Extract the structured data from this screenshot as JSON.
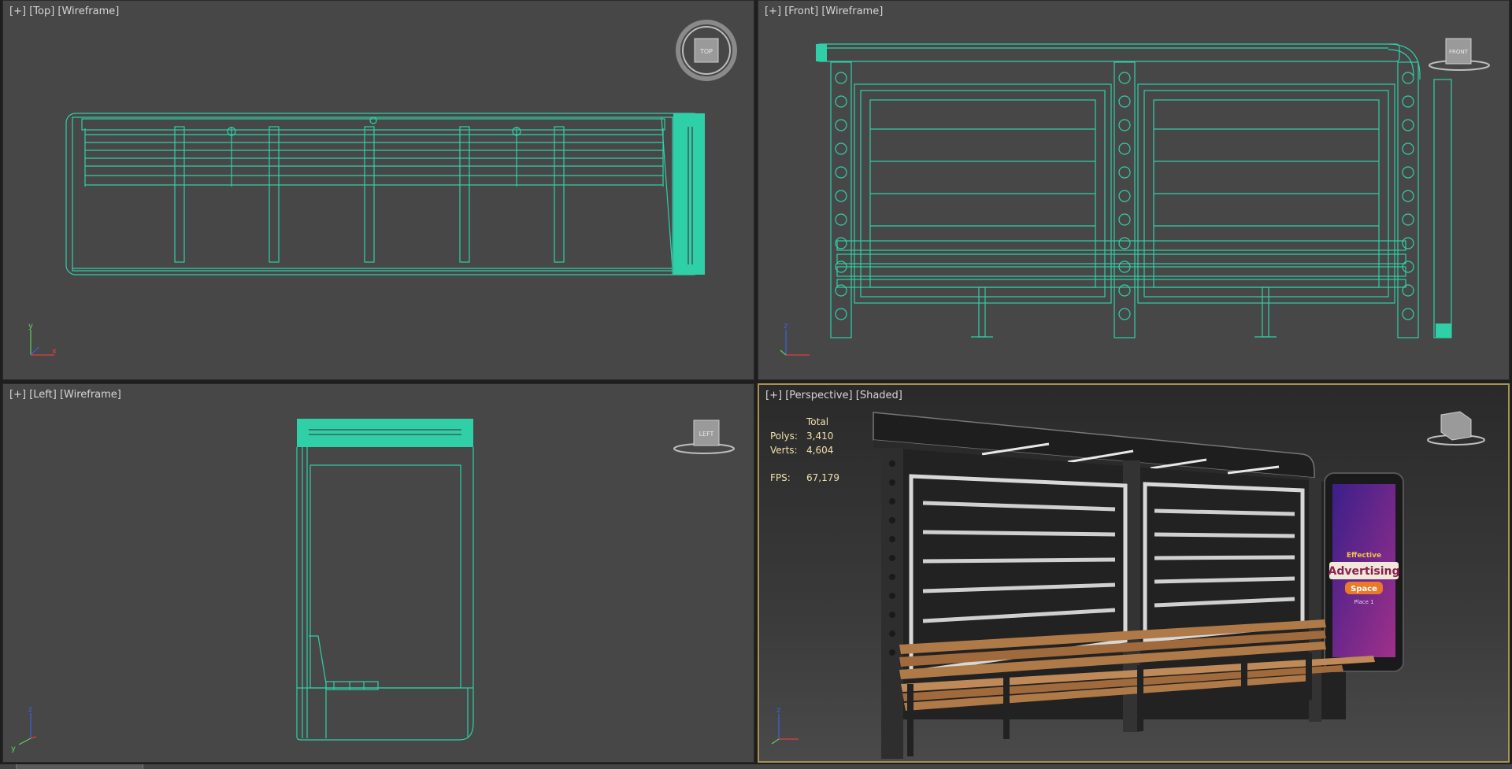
{
  "viewports": {
    "top": {
      "label_plus": "[+]",
      "label_view": "[Top]",
      "label_mode": "[Wireframe]",
      "cube_label": "TOP"
    },
    "front": {
      "label_plus": "[+]",
      "label_view": "[Front]",
      "label_mode": "[Wireframe]",
      "cube_label": "FRONT"
    },
    "left": {
      "label_plus": "[+]",
      "label_view": "[Left]",
      "label_mode": "[Wireframe]",
      "cube_label": "LEFT"
    },
    "perspective": {
      "label_plus": "[+]",
      "label_view": "[Perspective]",
      "label_mode": "[Shaded]"
    }
  },
  "stats": {
    "header": "Total",
    "polys_label": "Polys:",
    "polys_value": "3,410",
    "verts_label": "Verts:",
    "verts_value": "4,604",
    "fps_label": "FPS:",
    "fps_value": "67,179"
  },
  "ad": {
    "line1": "Effective",
    "line2": "Advertising",
    "line3": "Space",
    "line4": "Place 1"
  },
  "axis": {
    "x": "x",
    "y": "y",
    "z": "z"
  },
  "colors": {
    "wireframe": "#2fd0a8",
    "viewport_bg": "#474747",
    "active_border": "#a7924f",
    "stats_text": "#f1e0a8"
  }
}
